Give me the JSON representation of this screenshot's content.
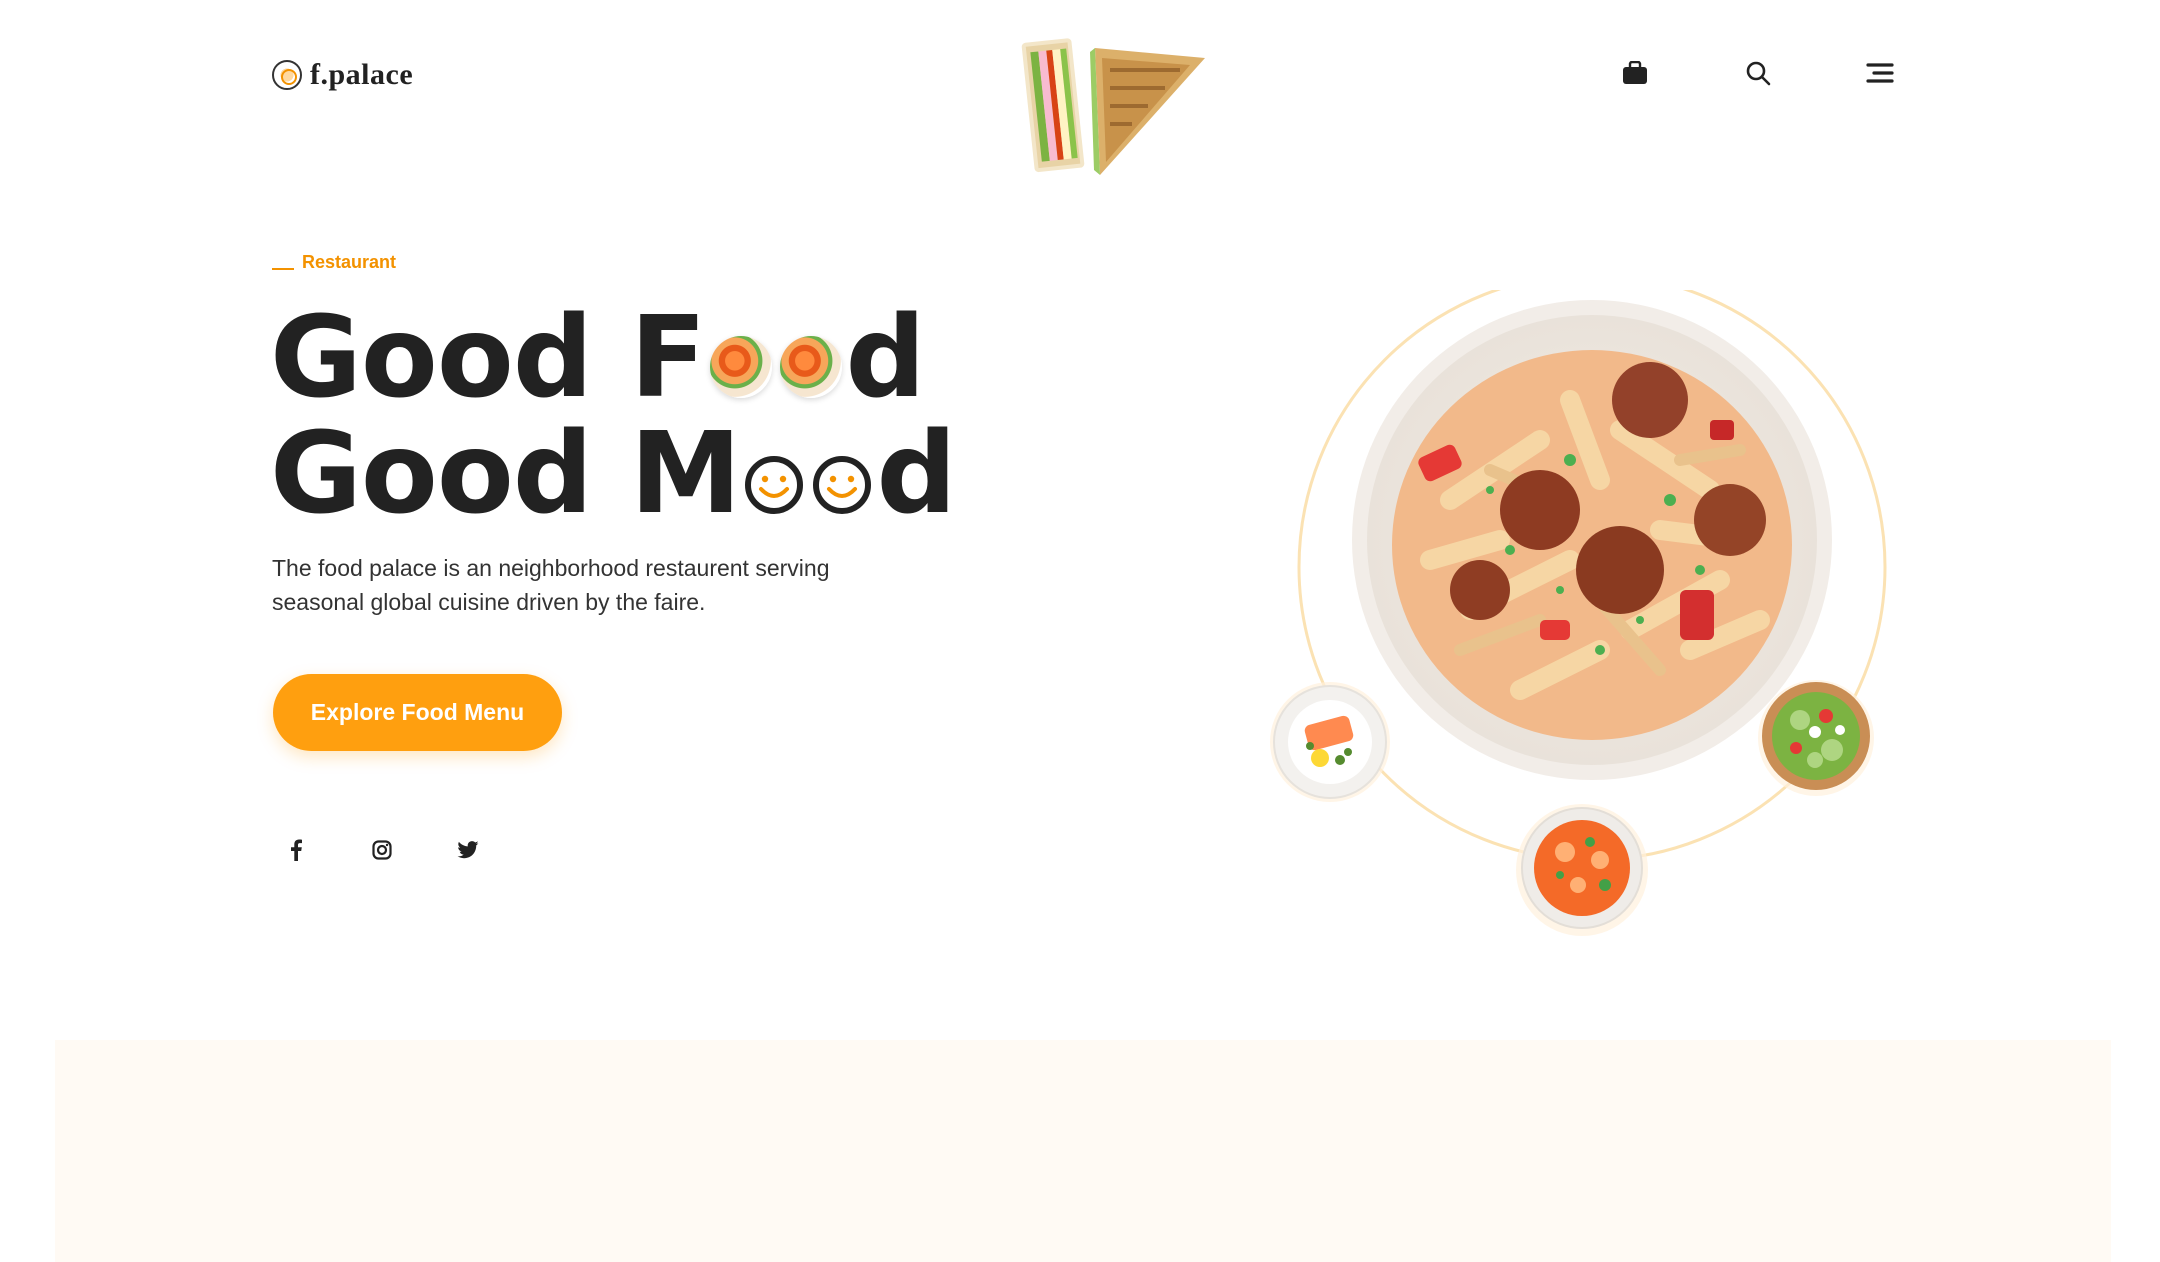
{
  "brand": {
    "name": "f.palace",
    "accent_color": "#ff9f0f",
    "text_color": "#222222"
  },
  "header": {
    "center_image": "sandwich-image",
    "icons": [
      "shopping-bag-icon",
      "search-icon",
      "hamburger-menu-icon"
    ]
  },
  "hero": {
    "eyebrow": "Restaurant",
    "headline_line1_start": "Good F",
    "headline_line1_end": "d",
    "headline_line2_start": "Good M",
    "headline_line2_end": "d",
    "description": "The food palace is an neighborhood restaurent serving seasonal global cuisine driven by the faire.",
    "cta_label": "Explore Food Menu"
  },
  "social": {
    "icons": [
      "facebook-icon",
      "instagram-icon",
      "twitter-icon"
    ]
  },
  "visual": {
    "main_dish": "pasta-meatball-bowl",
    "side_dishes": [
      "salmon-plate",
      "seafood-soup-bowl",
      "salad-bowl"
    ]
  }
}
